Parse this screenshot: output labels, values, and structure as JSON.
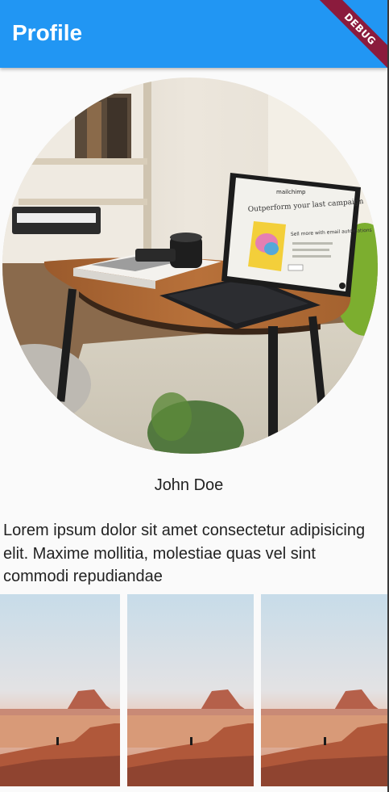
{
  "appbar": {
    "title": "Profile",
    "debug_label": "DEBUG"
  },
  "profile": {
    "name": "John Doe",
    "bio": "Lorem ipsum dolor sit amet consectetur adipisicing elit. Maxime mollitia, molestiae quas vel sint commodi repudiandae"
  },
  "laptop_screen": {
    "brand": "mailchimp",
    "headline": "Outperform your last campaign",
    "subhead": "Sell more with email automations"
  },
  "gallery": {
    "tile_count": 3
  },
  "colors": {
    "appbar": "#2196f3",
    "debug": "#8b1b3d",
    "background": "#fafafa"
  }
}
